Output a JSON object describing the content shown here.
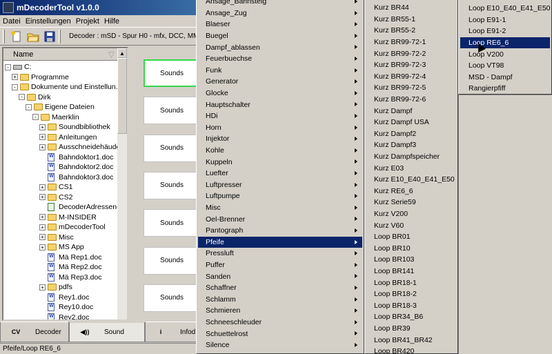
{
  "window": {
    "title": "mDecoderTool v1.0.0"
  },
  "menubar": [
    "Datei",
    "Einstellungen",
    "Projekt",
    "Hilfe"
  ],
  "toolbar": {
    "decoder_info": "Decoder : mSD - Spur H0 - mfx, DCC, MM"
  },
  "tree": {
    "header": "Name",
    "rows": [
      {
        "label": "C:",
        "indent": 0,
        "icon": "drive",
        "expander": "-"
      },
      {
        "label": "Programme",
        "indent": 1,
        "icon": "folder",
        "expander": "+"
      },
      {
        "label": "Dokumente und Einstellun...",
        "indent": 1,
        "icon": "folder",
        "expander": "-"
      },
      {
        "label": "Dirk",
        "indent": 2,
        "icon": "folder",
        "expander": "-"
      },
      {
        "label": "Eigene Dateien",
        "indent": 3,
        "icon": "folder",
        "expander": "-"
      },
      {
        "label": "Maerklin",
        "indent": 4,
        "icon": "folder",
        "expander": "-"
      },
      {
        "label": "Soundbibliothek",
        "indent": 5,
        "icon": "folder",
        "expander": "+"
      },
      {
        "label": "Anleitungen",
        "indent": 5,
        "icon": "folder",
        "expander": "+"
      },
      {
        "label": "Ausschneidehäuder",
        "indent": 5,
        "icon": "folder",
        "expander": "+"
      },
      {
        "label": "Bahndoktor1.doc",
        "indent": 5,
        "icon": "doc",
        "expander": ""
      },
      {
        "label": "Bahndoktor2.doc",
        "indent": 5,
        "icon": "doc",
        "expander": ""
      },
      {
        "label": "Bahndoktor3.doc",
        "indent": 5,
        "icon": "doc",
        "expander": ""
      },
      {
        "label": "CS1",
        "indent": 5,
        "icon": "folder",
        "expander": "+"
      },
      {
        "label": "CS2",
        "indent": 5,
        "icon": "folder",
        "expander": "+"
      },
      {
        "label": "DecoderAdressen-DI...",
        "indent": 5,
        "icon": "sheet",
        "expander": ""
      },
      {
        "label": "M-INSIDER",
        "indent": 5,
        "icon": "folder",
        "expander": "+"
      },
      {
        "label": "mDecoderTool",
        "indent": 5,
        "icon": "folder",
        "expander": "+"
      },
      {
        "label": "Misc",
        "indent": 5,
        "icon": "folder",
        "expander": "+"
      },
      {
        "label": "MS App",
        "indent": 5,
        "icon": "folder",
        "expander": "+"
      },
      {
        "label": "Mä Rep1.doc",
        "indent": 5,
        "icon": "doc",
        "expander": ""
      },
      {
        "label": "Mä Rep2.doc",
        "indent": 5,
        "icon": "doc",
        "expander": ""
      },
      {
        "label": "Mä Rep3.doc",
        "indent": 5,
        "icon": "doc",
        "expander": ""
      },
      {
        "label": "pdfs",
        "indent": 5,
        "icon": "folder",
        "expander": "+"
      },
      {
        "label": "Rey1.doc",
        "indent": 5,
        "icon": "doc",
        "expander": ""
      },
      {
        "label": "Rey10.doc",
        "indent": 5,
        "icon": "doc",
        "expander": ""
      },
      {
        "label": "Rey2.doc",
        "indent": 5,
        "icon": "doc",
        "expander": ""
      }
    ]
  },
  "sound_buttons": [
    "Sounds",
    "Sounds",
    "Sounds",
    "Sounds",
    "Sounds",
    "Sounds",
    "Sounds"
  ],
  "bottom_tabs": [
    {
      "icon": "CV",
      "label": "Decoder"
    },
    {
      "icon": "◀))",
      "label": "Sound"
    },
    {
      "icon": "i",
      "label": "Infod"
    }
  ],
  "status": "Pfeife/Loop RE6_6",
  "menu1": {
    "highlighted": "Pfeife",
    "items": [
      "Ansage_Bahnsteig",
      "Ansage_Zug",
      "Blaeser",
      "Buegel",
      "Dampf_ablassen",
      "Feuerbuechse",
      "Funk",
      "Generator",
      "Glocke",
      "Hauptschalter",
      "HDi",
      "Horn",
      "Injektor",
      "Kohle",
      "Kuppeln",
      "Luefter",
      "Luftpresser",
      "Luftpumpe",
      "Misc",
      "Oel-Brenner",
      "Pantograph",
      "Pfeife",
      "Pressluft",
      "Puffer",
      "Sanden",
      "Schaffner",
      "Schlamm",
      "Schmieren",
      "Schneeschleuder",
      "Schuettelrost",
      "Silence"
    ]
  },
  "menu2": {
    "items": [
      "Kurz BR44",
      "Kurz BR55-1",
      "Kurz BR55-2",
      "Kurz BR99-72-1",
      "Kurz BR99-72-2",
      "Kurz BR99-72-3",
      "Kurz BR99-72-4",
      "Kurz BR99-72-5",
      "Kurz BR99-72-6",
      "Kurz Dampf",
      "Kurz Dampf USA",
      "Kurz Dampf2",
      "Kurz Dampf3",
      "Kurz Dampfspeicher",
      "Kurz E03",
      "Kurz E10_E40_E41_E50",
      "Kurz RE6_6",
      "Kurz Serie59",
      "Kurz V200",
      "Kurz V60",
      "Loop BR01",
      "Loop BR10",
      "Loop BR103",
      "Loop BR141",
      "Loop BR18-1",
      "Loop BR18-2",
      "Loop BR18-3",
      "Loop BR34_B6",
      "Loop BR39",
      "Loop BR41_BR42",
      "Loop BR420"
    ]
  },
  "menu3": {
    "highlighted": "Loop RE6_6",
    "items": [
      "Loop E10_E40_E41_E50",
      "Loop E91-1",
      "Loop E91-2",
      "Loop RE6_6",
      "Loop V200",
      "Loop VT98",
      "MSD - Dampf",
      "Rangierpfiff"
    ]
  }
}
